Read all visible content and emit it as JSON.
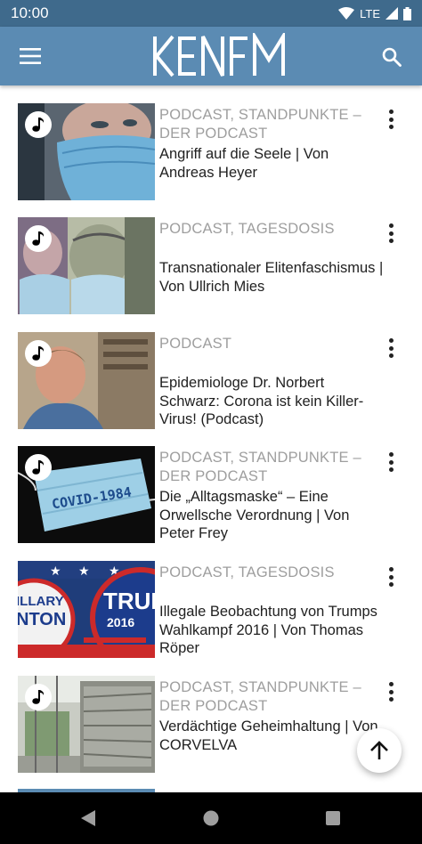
{
  "status": {
    "time": "10:00",
    "network": "LTE"
  },
  "app_bar": {
    "logo_text": "KENFM"
  },
  "items": [
    {
      "categories": "PODCAST, STANDPUNKTE – DER PODCAST",
      "title": "Angriff auf die Seele | Von Andreas Heyer"
    },
    {
      "categories": "PODCAST, TAGESDOSIS",
      "title": "Transnationaler Elitenfaschismus | Von Ullrich Mies"
    },
    {
      "categories": "PODCAST",
      "title": "Epidemiologe Dr. Norbert Schwarz: Corona ist kein Killer-Virus! (Podcast)"
    },
    {
      "categories": "PODCAST, STANDPUNKTE – DER PODCAST",
      "title": "Die „Alltagsmaske“ – Eine Orwellsche Verordnung | Von Peter Frey"
    },
    {
      "categories": "PODCAST, TAGESDOSIS",
      "title": "Illegale Beobachtung von Trumps Wahlkampf 2016 | Von Thomas Röper"
    },
    {
      "categories": "PODCAST, STANDPUNKTE – DER PODCAST",
      "title": "Verdächtige Geheimhaltung | Von CORVELVA"
    }
  ],
  "thumb_text": {
    "item4_mask": "COVID-1984",
    "item5_left_top": "ILLARY",
    "item5_left_mid": "NTON",
    "item5_right_top": "TRUM",
    "item5_right_mid": "2016"
  },
  "icons": {
    "menu": "menu-icon",
    "search": "search-icon",
    "music": "music-note-icon",
    "more": "more-vert-icon",
    "scroll_top": "arrow-up-icon",
    "back": "nav-back-icon",
    "home": "nav-home-icon",
    "recents": "nav-recents-icon"
  },
  "colors": {
    "status_bar": "#3f6a8c",
    "app_bar": "#5b8bb3",
    "category_text": "#9e9e9e",
    "title_text": "#212121"
  }
}
